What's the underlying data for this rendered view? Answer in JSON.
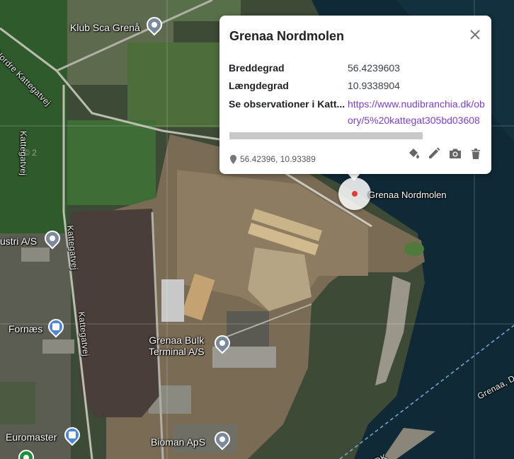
{
  "popup": {
    "title": "Grenaa Nordmolen",
    "rows": [
      {
        "key": "Breddegrad",
        "value": "56.4239603"
      },
      {
        "key": "Længdegrad",
        "value": "10.9338904"
      },
      {
        "key": "Se observationer i Katt...",
        "link_line1": "https://www.nudibranchia.dk/ob",
        "link_line2": "ory/5%20kattegat305bd03608"
      }
    ],
    "coordinates": "56.42396, 10.93389",
    "tools": [
      "paint-bucket-icon",
      "pencil-icon",
      "camera-icon",
      "trash-icon"
    ]
  },
  "selected_marker_label": "Grenaa Nordmolen",
  "places": [
    {
      "name": "Klub Sca Grenå",
      "icon": "grey-pin"
    },
    {
      "name": "ustri A/S",
      "icon": "grey-pin"
    },
    {
      "name": "Fornæs",
      "icon": "shopping-bag-pin"
    },
    {
      "name": "Grenaa Bulk\nTerminal A/S",
      "icon": "grey-pin"
    },
    {
      "name": "Euromaster",
      "icon": "shopping-bag-pin"
    },
    {
      "name": "Bioman ApS",
      "icon": "grey-pin"
    }
  ],
  "roads": [
    "Nordre Kattegatvej",
    "Kattegatvej",
    "Kattegatvej",
    "Kattegatvej",
    "Grenaa, D",
    "DK"
  ],
  "watermark": "© 2"
}
